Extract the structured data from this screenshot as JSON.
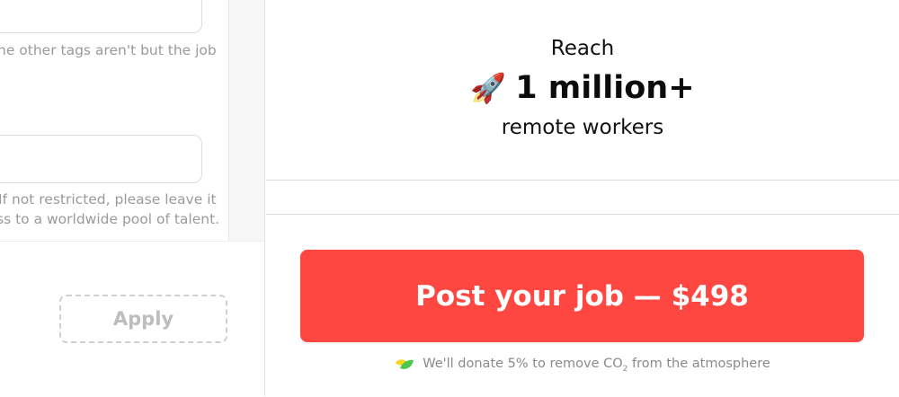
{
  "form": {
    "helper_top": "he other tags aren't but the job",
    "helper_mid_line1": "If not restricted, please leave it",
    "helper_mid_line2": "ss to a worldwide pool of talent.",
    "apply_label": "Apply"
  },
  "preview": {
    "reach_label": "Reach",
    "reach_icon": "rocket-icon",
    "reach_count": "1 million+",
    "reach_sub": "remote workers"
  },
  "checkout": {
    "post_button_label": "Post your job — $498",
    "donate_pre": "We'll donate 5% to remove CO",
    "donate_sub": "2",
    "donate_post": " from the atmosphere",
    "donate_icon": "leaf-icon"
  },
  "colors": {
    "accent": "#ff4742",
    "leaf_green": "#4cc94c",
    "leaf_yellow": "#f5d51e"
  }
}
